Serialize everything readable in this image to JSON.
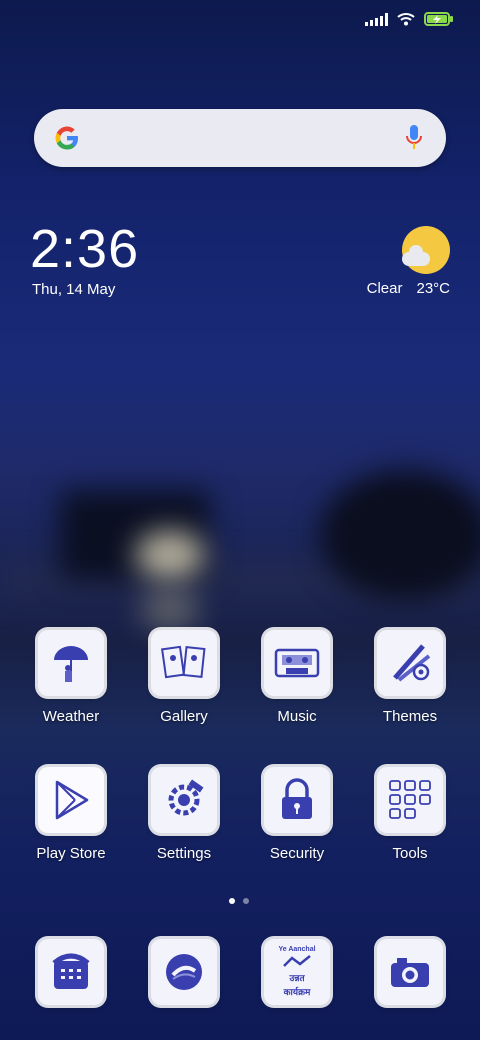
{
  "clock": {
    "time": "2:36",
    "date": "Thu, 14 May"
  },
  "weather_widget": {
    "condition": "Clear",
    "temperature": "23°C"
  },
  "search_bar": {
    "logo": "google-g-icon",
    "mic": "mic-icon"
  },
  "apps": [
    {
      "label": "Weather",
      "icon": "umbrella-sketch-icon"
    },
    {
      "label": "Gallery",
      "icon": "photos-sketch-icon"
    },
    {
      "label": "Music",
      "icon": "cassette-sketch-icon"
    },
    {
      "label": "Themes",
      "icon": "brushes-sketch-icon"
    },
    {
      "label": "Play Store",
      "icon": "play-triangle-icon"
    },
    {
      "label": "Settings",
      "icon": "gear-sketch-icon"
    },
    {
      "label": "Security",
      "icon": "padlock-sketch-icon"
    },
    {
      "label": "Tools",
      "icon": "tools-grid-icon"
    }
  ],
  "dock": [
    {
      "icon": "phone-sketch-icon"
    },
    {
      "icon": "browser-sketch-icon"
    },
    {
      "icon": "messaging-sketch-icon"
    },
    {
      "icon": "camera-sketch-icon"
    }
  ],
  "dock_icon_text": {
    "line1": "Ye Aanchal",
    "line2": "उन्नत",
    "line3": "कार्यक्रम"
  },
  "page_indicator": {
    "pages": 2,
    "current": 1
  },
  "colors": {
    "ink": "#3a3fb0",
    "sun": "#f5c842",
    "mic_blue": "#4285f4",
    "battery": "#8bd94a"
  }
}
